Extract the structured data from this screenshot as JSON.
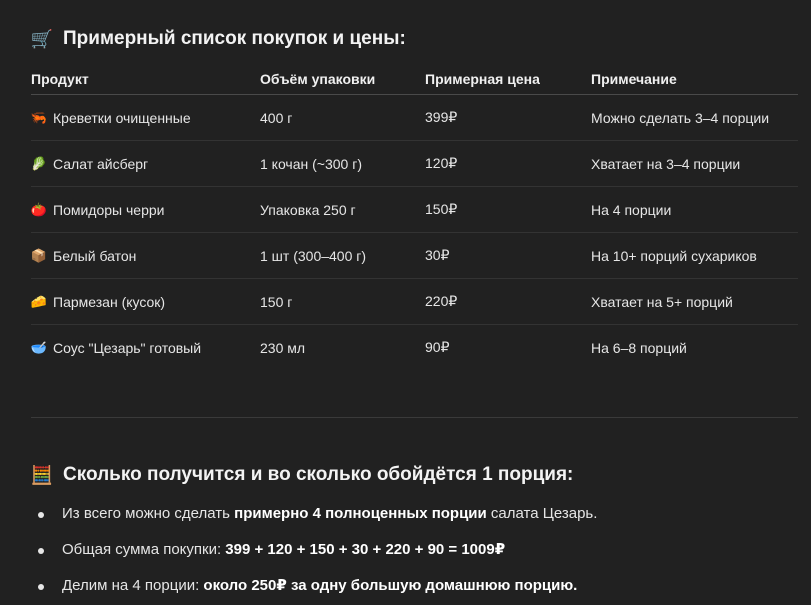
{
  "section1": {
    "icon": "shopping-cart-icon",
    "icon_glyph": "🛒",
    "title": "Примерный список покупок и цены:"
  },
  "table": {
    "headers": [
      "Продукт",
      "Объём упаковки",
      "Примерная цена",
      "Примечание"
    ],
    "rows": [
      {
        "icon": "shrimp-icon",
        "glyph": "🦐",
        "product": "Креветки очищенные",
        "pack": "400 г",
        "price": "399₽",
        "note": "Можно сделать 3–4 порции"
      },
      {
        "icon": "lettuce-icon",
        "glyph": "🥬",
        "product": "Салат айсберг",
        "pack": "1 кочан (~300 г)",
        "price": "120₽",
        "note": "Хватает на 3–4 порции"
      },
      {
        "icon": "tomato-icon",
        "glyph": "🍅",
        "product": "Помидоры черри",
        "pack": "Упаковка 250 г",
        "price": "150₽",
        "note": "На 4 порции"
      },
      {
        "icon": "package-icon",
        "glyph": "📦",
        "product": "Белый батон",
        "pack": "1 шт (300–400 г)",
        "price": "30₽",
        "note": "На 10+ порций сухариков"
      },
      {
        "icon": "cheese-icon",
        "glyph": "🧀",
        "product": "Пармезан (кусок)",
        "pack": "150 г",
        "price": "220₽",
        "note": "Хватает на 5+ порций"
      },
      {
        "icon": "sauce-bowl-icon",
        "glyph": "🥣",
        "product": "Соус \"Цезарь\" готовый",
        "pack": "230 мл",
        "price": "90₽",
        "note": "На 6–8 порций"
      }
    ]
  },
  "section2": {
    "icon": "abacus-icon",
    "icon_glyph": "🧮",
    "title": "Сколько получится и во сколько обойдётся 1 порция:"
  },
  "bullets": [
    {
      "pre": "Из всего можно сделать ",
      "bold": "примерно 4 полноценных порции",
      "post": " салата Цезарь."
    },
    {
      "pre": "Общая сумма покупки: ",
      "bold": "399 + 120 + 150 + 30 + 220 + 90 = 1009₽",
      "post": ""
    },
    {
      "pre": "Делим на 4 порции: ",
      "bold": "около 250₽ за одну большую домашнюю порцию.",
      "post": ""
    }
  ]
}
